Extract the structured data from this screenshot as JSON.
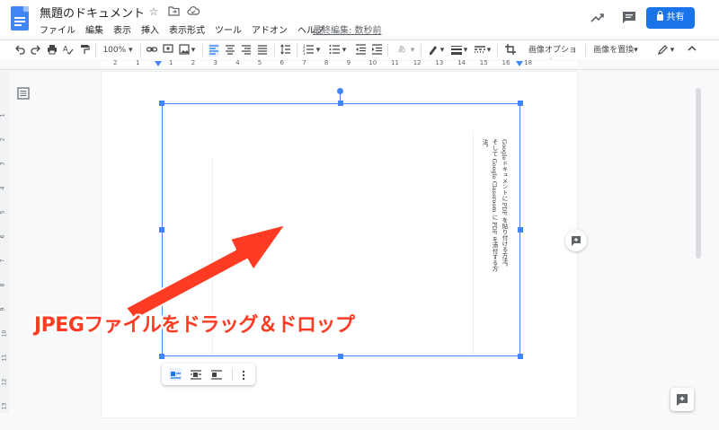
{
  "header": {
    "doc_title": "無題のドキュメント",
    "menus": [
      "ファイル",
      "編集",
      "表示",
      "挿入",
      "表示形式",
      "ツール",
      "アドオン",
      "ヘルプ"
    ],
    "last_edit": "最終編集: 数秒前",
    "share_label": "共有"
  },
  "toolbar": {
    "zoom": "100%",
    "font_sample": "あ",
    "image_options": "画像オプション",
    "replace_image": "画像を置換"
  },
  "ruler": {
    "numbers": [
      "2",
      "1",
      "1",
      "2",
      "3",
      "4",
      "5",
      "6",
      "7",
      "8",
      "9",
      "10",
      "11",
      "12",
      "13",
      "14",
      "15",
      "16",
      "18"
    ]
  },
  "vertical_ruler": {
    "numbers": [
      "1",
      "2",
      "3",
      "4",
      "5",
      "6",
      "7",
      "8",
      "9",
      "10",
      "11",
      "12",
      "13"
    ]
  },
  "document": {
    "image_text_line1": "Googleドキュメントに PDF を貼り付ける方法。",
    "image_text_line2": "そして Google Classroom に PDF を添付する方法。"
  },
  "annotation": {
    "label": "JPEGファイルをドラッグ＆ドロップ"
  },
  "colors": {
    "accent": "#4285f4",
    "share_button": "#1a73e8",
    "annotation": "#ff3b23"
  }
}
